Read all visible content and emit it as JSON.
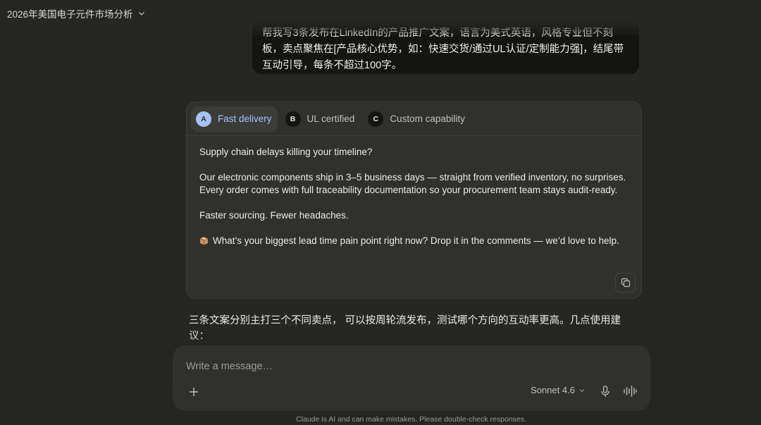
{
  "header": {
    "conversation_title": "2026年美国电子元件市场分析"
  },
  "user_message": {
    "text_line1": "帮我写3条发布在LinkedIn的产品推广文案，语言为美式英语，风格专业但不刻",
    "text_line2": "板，卖点聚焦在[产品核心优势，如：快速交货/通过UL认证/定制能力强]，结尾带",
    "text_line3": "互动引导，每条不超过100字。"
  },
  "variants": {
    "tabs": [
      {
        "letter": "A",
        "label": "Fast delivery",
        "active": true
      },
      {
        "letter": "B",
        "label": "UL certified",
        "active": false
      },
      {
        "letter": "C",
        "label": "Custom capability",
        "active": false
      }
    ],
    "body": {
      "p1": "Supply chain delays killing your timeline?",
      "p2a": "Our electronic components ship in 3–5 business days — straight from verified inventory, no surprises.",
      "p2b": "Every order comes with full traceability documentation so your procurement team stays audit-ready.",
      "p3": "Faster sourcing. Fewer headaches.",
      "p4": "What’s your biggest lead time pain point right now? Drop it in the comments — we’d love to help.",
      "p4_icon": "package-emoji-icon"
    }
  },
  "assistant_text": {
    "line1": "三条文案分别主打三个不同卖点， 可以按周轮流发布，测试哪个方向的互动率更高。几点使用建",
    "line2": "议："
  },
  "composer": {
    "placeholder": "Write a message…",
    "model_label": "Sonnet 4.6"
  },
  "footer": {
    "disclaimer": "Claude is AI and can make mistakes. Please double-check responses."
  },
  "colors": {
    "background": "#262624",
    "card": "#30302e",
    "user_bubble": "#141413",
    "accent_blue": "#a6c4f2"
  }
}
